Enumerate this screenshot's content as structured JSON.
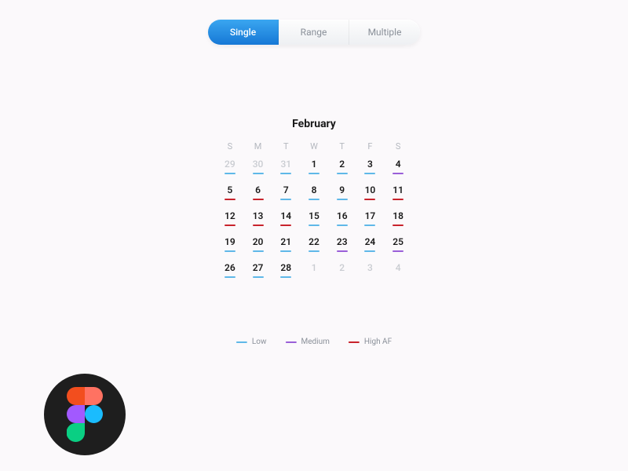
{
  "tabs": [
    {
      "label": "Single",
      "active": true
    },
    {
      "label": "Range",
      "active": false
    },
    {
      "label": "Multiple",
      "active": false
    }
  ],
  "calendar": {
    "title": "February",
    "weekdays": [
      "S",
      "M",
      "T",
      "W",
      "T",
      "F",
      "S"
    ],
    "days": [
      {
        "n": 29,
        "muted": true,
        "level": "low"
      },
      {
        "n": 30,
        "muted": true,
        "level": "low"
      },
      {
        "n": 31,
        "muted": true,
        "level": "low"
      },
      {
        "n": 1,
        "muted": false,
        "level": "low"
      },
      {
        "n": 2,
        "muted": false,
        "level": "low"
      },
      {
        "n": 3,
        "muted": false,
        "level": "low"
      },
      {
        "n": 4,
        "muted": false,
        "level": "med"
      },
      {
        "n": 5,
        "muted": false,
        "level": "high"
      },
      {
        "n": 6,
        "muted": false,
        "level": "high"
      },
      {
        "n": 7,
        "muted": false,
        "level": "low"
      },
      {
        "n": 8,
        "muted": false,
        "level": "low"
      },
      {
        "n": 9,
        "muted": false,
        "level": "low"
      },
      {
        "n": 10,
        "muted": false,
        "level": "high"
      },
      {
        "n": 11,
        "muted": false,
        "level": "high"
      },
      {
        "n": 12,
        "muted": false,
        "level": "high"
      },
      {
        "n": 13,
        "muted": false,
        "level": "high"
      },
      {
        "n": 14,
        "muted": false,
        "level": "high"
      },
      {
        "n": 15,
        "muted": false,
        "level": "low"
      },
      {
        "n": 16,
        "muted": false,
        "level": "low"
      },
      {
        "n": 17,
        "muted": false,
        "level": "low"
      },
      {
        "n": 18,
        "muted": false,
        "level": "high"
      },
      {
        "n": 19,
        "muted": false,
        "level": "low"
      },
      {
        "n": 20,
        "muted": false,
        "level": "low"
      },
      {
        "n": 21,
        "muted": false,
        "level": "low"
      },
      {
        "n": 22,
        "muted": false,
        "level": "low"
      },
      {
        "n": 23,
        "muted": false,
        "level": "med"
      },
      {
        "n": 24,
        "muted": false,
        "level": "low"
      },
      {
        "n": 25,
        "muted": false,
        "level": "med"
      },
      {
        "n": 26,
        "muted": false,
        "level": "low"
      },
      {
        "n": 27,
        "muted": false,
        "level": "low"
      },
      {
        "n": 28,
        "muted": false,
        "level": "low"
      },
      {
        "n": 1,
        "muted": true,
        "level": "none"
      },
      {
        "n": 2,
        "muted": true,
        "level": "none"
      },
      {
        "n": 3,
        "muted": true,
        "level": "none"
      },
      {
        "n": 4,
        "muted": true,
        "level": "none"
      }
    ]
  },
  "legend": [
    {
      "label": "Low",
      "level": "low"
    },
    {
      "label": "Medium",
      "level": "med"
    },
    {
      "label": "High AF",
      "level": "high"
    }
  ],
  "logo_name": "figma-logo"
}
